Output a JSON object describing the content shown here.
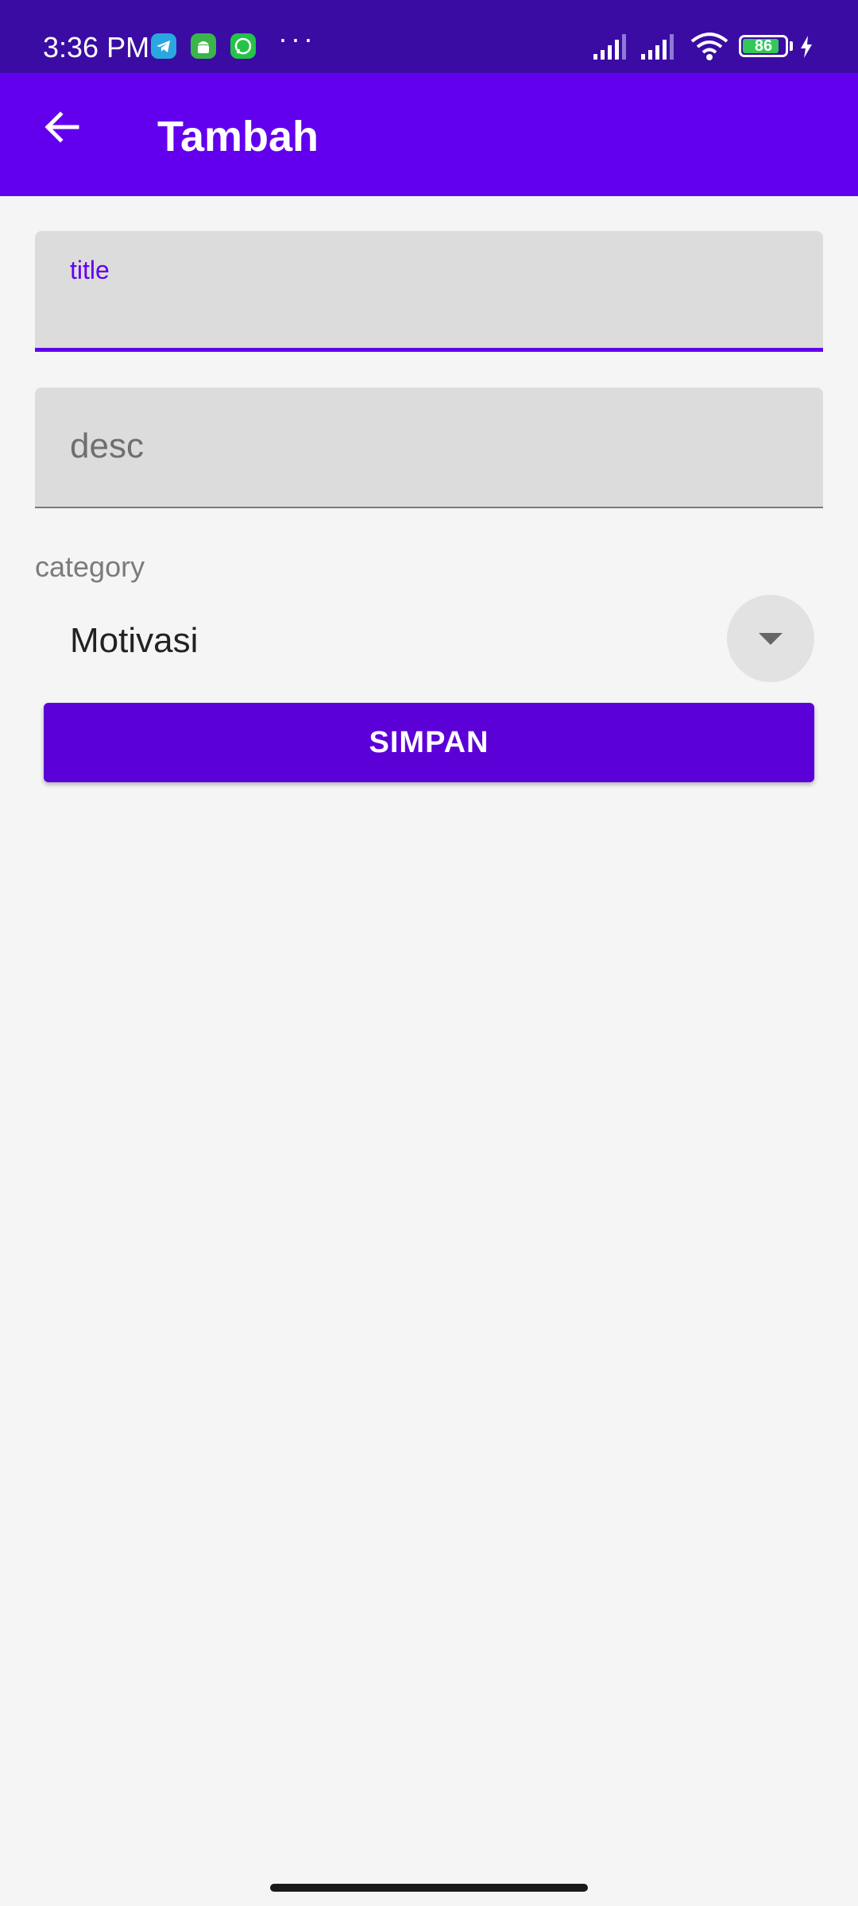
{
  "status_bar": {
    "time": "3:36 PM",
    "notifications": [
      "telegram-icon",
      "android-icon",
      "whatsapp-icon"
    ],
    "more": "···",
    "battery_level": "86",
    "colors": {
      "background": "#3a0ca3",
      "battery_fill": "#34c759"
    }
  },
  "app_bar": {
    "title": "Tambah",
    "back_icon": "arrow-left-icon",
    "color": "#6200ee"
  },
  "form": {
    "title_field": {
      "label": "title",
      "value": ""
    },
    "desc_field": {
      "placeholder": "desc",
      "value": ""
    },
    "category": {
      "label": "category",
      "selected": "Motivasi",
      "dropdown_icon": "chevron-down-icon"
    },
    "save_label": "SIMPAN"
  },
  "colors": {
    "accent": "#6200ee",
    "button": "#5c00d8",
    "background": "#f5f5f5"
  }
}
